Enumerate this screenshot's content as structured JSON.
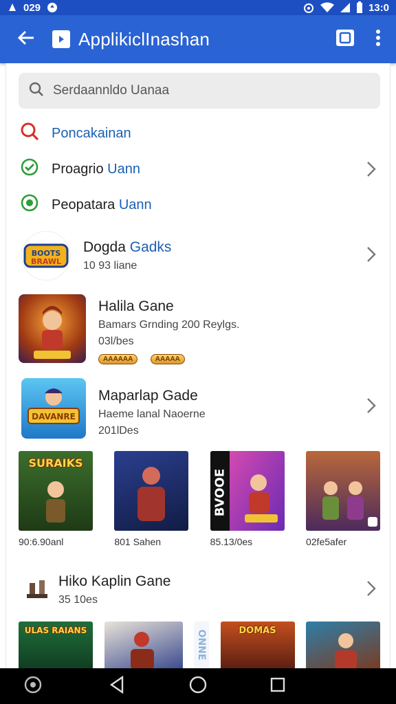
{
  "status_bar": {
    "left_time": "029",
    "right_time": "13:0"
  },
  "app_bar": {
    "title": "ApplikiclInashan"
  },
  "search": {
    "placeholder": "Serdaannldo Uanaa"
  },
  "menu": [
    {
      "label": "Poncakainan",
      "icon": "search-icon",
      "color": "#d93025"
    },
    {
      "label_a": "Proagrio",
      "label_b": "Uann",
      "icon": "check-circle-icon",
      "color": "#2e9d3a"
    },
    {
      "label_a": "Peopatara",
      "label_b": "Uann",
      "icon": "check-circle-icon",
      "color": "#2e9d3a"
    }
  ],
  "games": [
    {
      "name_a": "Dogda",
      "name_b": "Gadks",
      "sub": "10 93 liane",
      "logo_text": "BOOTS BRAWL"
    },
    {
      "name": "Halila Gane",
      "sub1": "Bamars Grnding 200 Reylgs.",
      "sub2": "03l/bes",
      "badges": [
        "AAAAAA",
        "AAAAA"
      ]
    },
    {
      "name": "Maparlap Gade",
      "sub1": "Haeme lanal Naoerne",
      "sub2": "201lDes",
      "logo_text": "DAVANRE"
    }
  ],
  "tiles": [
    {
      "art_text": "SURAIKS",
      "caption": "90:6.90anl"
    },
    {
      "art_text": "",
      "caption": "801 Sahen"
    },
    {
      "art_text": "BVOOE",
      "caption": "85.13/0es"
    },
    {
      "art_text": "",
      "caption": "02fe5afer"
    }
  ],
  "section": {
    "title": "Hiko Kaplin Gane",
    "sub": "35 10es"
  },
  "tiles2": [
    {
      "art_text": "ULAS RAIANS"
    },
    {
      "art_text": ""
    },
    {
      "art_text": "ONNE"
    },
    {
      "art_text": "DOMAS"
    },
    {
      "art_text": ""
    }
  ],
  "colors": {
    "status_bar": "#1d4fc2",
    "app_bar": "#2a63d4",
    "accent_blue": "#1a5fb4"
  }
}
